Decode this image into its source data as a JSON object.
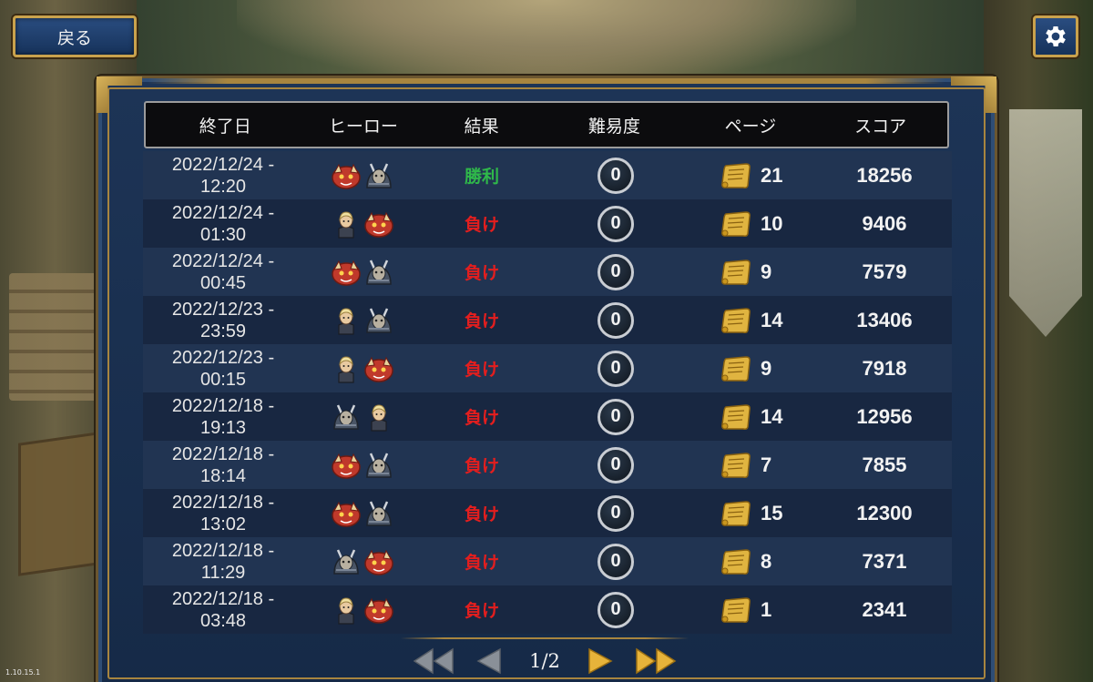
{
  "header": {
    "back_label": "戻る",
    "settings_icon": "gear-icon"
  },
  "table": {
    "columns": [
      "終了日",
      "ヒーロー",
      "結果",
      "難易度",
      "ページ",
      "スコア"
    ],
    "rows": [
      {
        "date": "2022/12/24 -\n12:20",
        "heroes": [
          "red-beast",
          "armored-knight"
        ],
        "result": "勝利",
        "result_type": "win",
        "difficulty": "0",
        "pages": "21",
        "score": "18256"
      },
      {
        "date": "2022/12/24 -\n01:30",
        "heroes": [
          "blonde-warrior",
          "red-beast"
        ],
        "result": "負け",
        "result_type": "lose",
        "difficulty": "0",
        "pages": "10",
        "score": "9406"
      },
      {
        "date": "2022/12/24 -\n00:45",
        "heroes": [
          "red-beast",
          "armored-knight"
        ],
        "result": "負け",
        "result_type": "lose",
        "difficulty": "0",
        "pages": "9",
        "score": "7579"
      },
      {
        "date": "2022/12/23 -\n23:59",
        "heroes": [
          "blonde-warrior",
          "armored-knight"
        ],
        "result": "負け",
        "result_type": "lose",
        "difficulty": "0",
        "pages": "14",
        "score": "13406"
      },
      {
        "date": "2022/12/23 -\n00:15",
        "heroes": [
          "blonde-warrior",
          "red-beast"
        ],
        "result": "負け",
        "result_type": "lose",
        "difficulty": "0",
        "pages": "9",
        "score": "7918"
      },
      {
        "date": "2022/12/18 -\n19:13",
        "heroes": [
          "armored-knight",
          "blonde-warrior"
        ],
        "result": "負け",
        "result_type": "lose",
        "difficulty": "0",
        "pages": "14",
        "score": "12956"
      },
      {
        "date": "2022/12/18 -\n18:14",
        "heroes": [
          "red-beast",
          "armored-knight"
        ],
        "result": "負け",
        "result_type": "lose",
        "difficulty": "0",
        "pages": "7",
        "score": "7855"
      },
      {
        "date": "2022/12/18 -\n13:02",
        "heroes": [
          "red-beast",
          "armored-knight"
        ],
        "result": "負け",
        "result_type": "lose",
        "difficulty": "0",
        "pages": "15",
        "score": "12300"
      },
      {
        "date": "2022/12/18 -\n11:29",
        "heroes": [
          "armored-knight",
          "red-beast"
        ],
        "result": "負け",
        "result_type": "lose",
        "difficulty": "0",
        "pages": "8",
        "score": "7371"
      },
      {
        "date": "2022/12/18 -\n03:48",
        "heroes": [
          "blonde-warrior",
          "red-beast"
        ],
        "result": "負け",
        "result_type": "lose",
        "difficulty": "0",
        "pages": "1",
        "score": "2341"
      }
    ]
  },
  "pagination": {
    "label": "1/2",
    "first_icon": "double-chevron-left-icon",
    "prev_icon": "chevron-left-icon",
    "next_icon": "chevron-right-icon",
    "last_icon": "double-chevron-right-icon"
  },
  "colors": {
    "win": "#2fb84a",
    "lose": "#e31e1e",
    "gold": "#c9a24d"
  },
  "version": "1.10.15.1"
}
